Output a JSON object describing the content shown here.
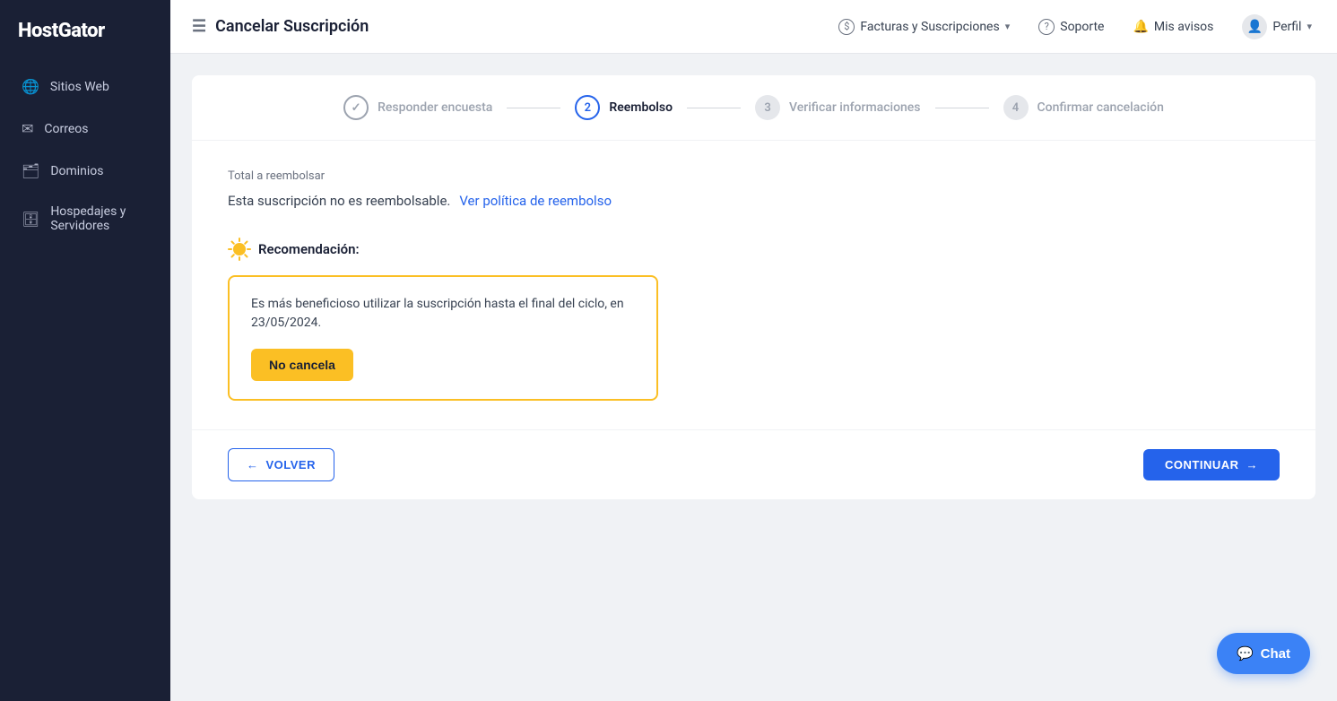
{
  "brand": {
    "name": "HostGator"
  },
  "sidebar": {
    "items": [
      {
        "id": "sitios-web",
        "label": "Sitios Web",
        "icon": "🌐"
      },
      {
        "id": "correos",
        "label": "Correos",
        "icon": "✉"
      },
      {
        "id": "dominios",
        "label": "Dominios",
        "icon": "🗂"
      },
      {
        "id": "hospedajes",
        "label": "Hospedajes y Servidores",
        "icon": "🗄"
      }
    ]
  },
  "topnav": {
    "page_title": "Cancelar Suscripción",
    "page_icon": "≡",
    "billing_label": "Facturas y Suscripciones",
    "support_label": "Soporte",
    "notifications_label": "Mis avisos",
    "profile_label": "Perfil"
  },
  "steps": [
    {
      "id": "step1",
      "number": "✓",
      "label": "Responder encuesta",
      "state": "completed"
    },
    {
      "id": "step2",
      "number": "2",
      "label": "Reembolso",
      "state": "active"
    },
    {
      "id": "step3",
      "number": "3",
      "label": "Verificar informaciones",
      "state": "inactive"
    },
    {
      "id": "step4",
      "number": "4",
      "label": "Confirmar cancelación",
      "state": "inactive"
    }
  ],
  "refund": {
    "section_title": "Total a reembolsar",
    "non_refundable_text": "Esta suscripción no es reembolsable.",
    "policy_link_text": "Ver política de reembolso"
  },
  "recommendation": {
    "header": "Recomendación:",
    "body_text": "Es más beneficioso utilizar la suscripción hasta el final del ciclo, en 23/05/2024.",
    "no_cancel_label": "No cancela"
  },
  "actions": {
    "back_label": "VOLVER",
    "continue_label": "CONTINUAR"
  },
  "chat": {
    "label": "Chat"
  }
}
